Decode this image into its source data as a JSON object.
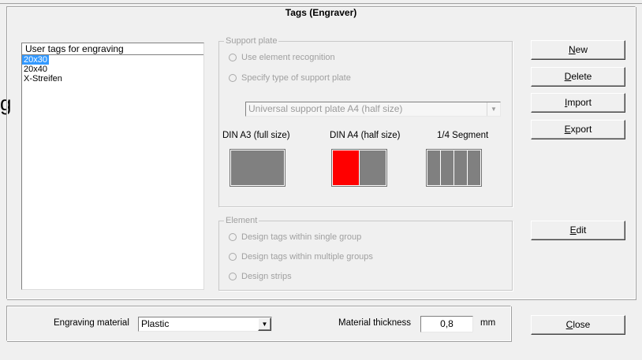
{
  "dialog": {
    "title": "Tags (Engraver)",
    "edge_glyph": "g"
  },
  "user_tags": {
    "header": "User tags for engraving",
    "items": [
      {
        "label": "20x30",
        "selected": true
      },
      {
        "label": "20x40",
        "selected": false
      },
      {
        "label": "X-Streifen",
        "selected": false
      }
    ]
  },
  "support_plate": {
    "legend": "Support plate",
    "options": [
      "Use element recognition",
      "Specify type of support plate"
    ],
    "enabled": false,
    "plate_type_value": "Universal support plate A4 (half size)",
    "plates": [
      {
        "label": "DIN A3 (full size)",
        "segments": 1,
        "highlighted_segments": 0
      },
      {
        "label": "DIN A4 (half size)",
        "segments": 2,
        "highlighted_segments": 1
      },
      {
        "label": "1/4 Segment",
        "segments": 4,
        "highlighted_segments": 0
      }
    ],
    "highlight_color": "#ff0000",
    "plate_color": "#808080"
  },
  "element": {
    "legend": "Element",
    "enabled": false,
    "options": [
      "Design tags within single group",
      "Design tags within multiple groups",
      "Design strips"
    ]
  },
  "buttons": {
    "new": {
      "accel": "N",
      "rest": "ew"
    },
    "delete": {
      "accel": "D",
      "rest": "elete"
    },
    "import": {
      "accel": "I",
      "rest": "mport"
    },
    "export": {
      "accel": "E",
      "rest": "xport"
    },
    "edit": {
      "accel": "E",
      "rest": "dit"
    },
    "close": {
      "accel": "C",
      "rest": "lose"
    }
  },
  "bottom": {
    "material_label": "Engraving material",
    "material_value": "Plastic",
    "thickness_label": "Material thickness",
    "thickness_value": "0,8",
    "thickness_unit": "mm"
  },
  "icons": {
    "dropdown": "chevron-down-icon",
    "radio": "radio-button-icon"
  }
}
